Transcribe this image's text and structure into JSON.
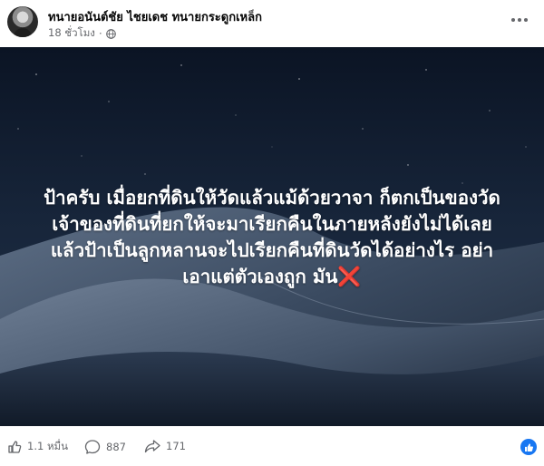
{
  "post": {
    "author": "ทนายอนันต์ชัย ไชยเดช ทนายกระดูกเหล็ก",
    "time": "18 ชั่วโมง",
    "audience_icon": "globe-icon",
    "more_icon": "more-options-icon"
  },
  "image": {
    "text_lines": [
      "ป้าครับ เมื่อยกที่ดินให้วัดแล้วแม้ด้วยวาจา ก็ตกเป็นของวัด",
      "เจ้าของที่ดินที่ยกให้จะมาเรียกคืนในภายหลังยังไม่ได้เลย",
      "แล้วป้าเป็นลูกหลานจะไปเรียกคืนที่ดินวัดได้อย่างไร อย่า",
      "เอาแต่ตัวเองถูก มัน"
    ],
    "emoji": "❌"
  },
  "actions": {
    "likes": "1.1 หมื่น",
    "comments": "887",
    "shares": "171"
  },
  "colors": {
    "accent": "#1877f2",
    "muted_text": "#65676b",
    "sky": "#0d1726"
  }
}
